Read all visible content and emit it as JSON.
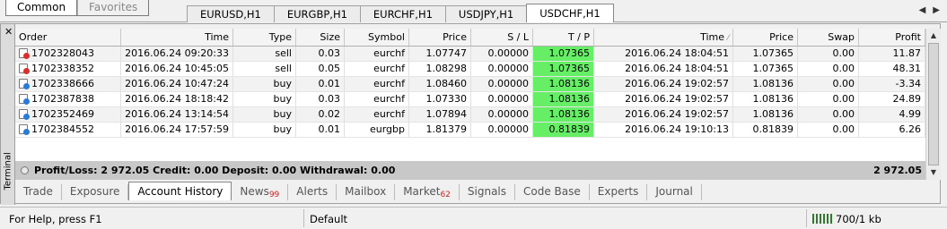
{
  "mode_tabs": [
    "Common",
    "Favorites"
  ],
  "chart_tabs": [
    "EURUSD,H1",
    "EURGBP,H1",
    "EURCHF,H1",
    "USDJPY,H1",
    "USDCHF,H1"
  ],
  "active_chart_tab": "USDCHF,H1",
  "terminal_label": "Terminal",
  "columns": [
    "Order",
    "Time",
    "Type",
    "Size",
    "Symbol",
    "Price",
    "S / L",
    "T / P",
    "Time",
    "Price",
    "Swap",
    "Profit"
  ],
  "close_time_sort_indicator": "⁄",
  "rows": [
    {
      "order": "1702328043",
      "open_time": "2016.06.24 09:20:33",
      "type": "sell",
      "size": "0.03",
      "symbol": "eurchf",
      "price": "1.07747",
      "sl": "0.00000",
      "tp": "1.07365",
      "close_time": "2016.06.24 18:04:51",
      "close_price": "1.07365",
      "swap": "0.00",
      "profit": "11.87"
    },
    {
      "order": "1702338352",
      "open_time": "2016.06.24 10:45:05",
      "type": "sell",
      "size": "0.05",
      "symbol": "eurchf",
      "price": "1.08298",
      "sl": "0.00000",
      "tp": "1.07365",
      "close_time": "2016.06.24 18:04:51",
      "close_price": "1.07365",
      "swap": "0.00",
      "profit": "48.31"
    },
    {
      "order": "1702338666",
      "open_time": "2016.06.24 10:47:24",
      "type": "buy",
      "size": "0.01",
      "symbol": "eurchf",
      "price": "1.08460",
      "sl": "0.00000",
      "tp": "1.08136",
      "close_time": "2016.06.24 19:02:57",
      "close_price": "1.08136",
      "swap": "0.00",
      "profit": "-3.34"
    },
    {
      "order": "1702387838",
      "open_time": "2016.06.24 18:18:42",
      "type": "buy",
      "size": "0.03",
      "symbol": "eurchf",
      "price": "1.07330",
      "sl": "0.00000",
      "tp": "1.08136",
      "close_time": "2016.06.24 19:02:57",
      "close_price": "1.08136",
      "swap": "0.00",
      "profit": "24.89"
    },
    {
      "order": "1702352469",
      "open_time": "2016.06.24 13:14:54",
      "type": "buy",
      "size": "0.02",
      "symbol": "eurchf",
      "price": "1.07894",
      "sl": "0.00000",
      "tp": "1.08136",
      "close_time": "2016.06.24 19:02:57",
      "close_price": "1.08136",
      "swap": "0.00",
      "profit": "4.99"
    },
    {
      "order": "1702384552",
      "open_time": "2016.06.24 17:57:59",
      "type": "buy",
      "size": "0.01",
      "symbol": "eurgbp",
      "price": "1.81379",
      "sl": "0.00000",
      "tp": "0.81839",
      "close_time": "2016.06.24 19:10:13",
      "close_price": "0.81839",
      "swap": "0.00",
      "profit": "6.26"
    }
  ],
  "summary": {
    "text": "Profit/Loss: 2 972.05  Credit: 0.00  Deposit: 0.00  Withdrawal: 0.00",
    "total": "2 972.05"
  },
  "bottom_tabs": [
    {
      "label": "Trade",
      "badge": ""
    },
    {
      "label": "Exposure",
      "badge": ""
    },
    {
      "label": "Account History",
      "badge": ""
    },
    {
      "label": "News",
      "badge": "99"
    },
    {
      "label": "Alerts",
      "badge": ""
    },
    {
      "label": "Mailbox",
      "badge": ""
    },
    {
      "label": "Market",
      "badge": "62"
    },
    {
      "label": "Signals",
      "badge": ""
    },
    {
      "label": "Code Base",
      "badge": ""
    },
    {
      "label": "Experts",
      "badge": ""
    },
    {
      "label": "Journal",
      "badge": ""
    }
  ],
  "active_bottom_tab": "Account History",
  "status": {
    "help": "For Help, press F1",
    "profile": "Default",
    "rate": "700/1 kb"
  },
  "colors": {
    "tp_highlight": "#66ee66",
    "sell_icon": "#d8302a",
    "buy_icon": "#2a7ad8",
    "badge": "#e02020"
  }
}
